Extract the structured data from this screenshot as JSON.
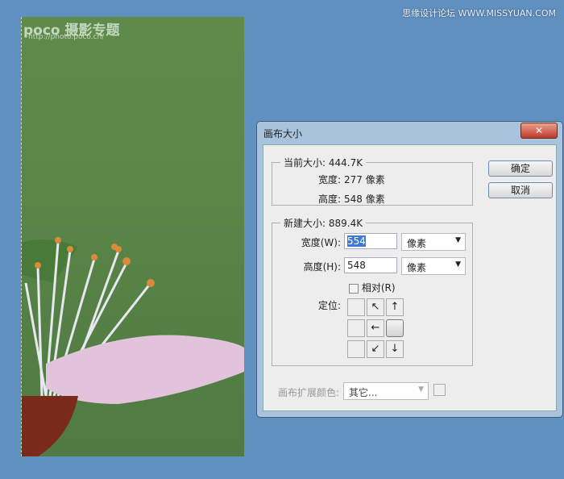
{
  "watermark": {
    "site": "思缘设计论坛 WWW.MISSYUAN.COM",
    "logo": "poco 摄影专题",
    "url": "http://photo.poco.cn/"
  },
  "dialog": {
    "title": "画布大小",
    "close": "✕",
    "current": {
      "legend": "当前大小: 444.7K",
      "width_label": "宽度:",
      "width_value": "277 像素",
      "height_label": "高度:",
      "height_value": "548 像素"
    },
    "new": {
      "legend": "新建大小: 889.4K",
      "width_label": "宽度(W):",
      "width_value": "554",
      "width_unit": "像素",
      "height_label": "高度(H):",
      "height_value": "548",
      "height_unit": "像素",
      "relative": "相对(R)",
      "anchor_label": "定位:",
      "anchor": [
        "",
        "↖",
        "↑",
        "",
        "←",
        "",
        "",
        "↙",
        "↓"
      ]
    },
    "ok": "确定",
    "cancel": "取消",
    "ext_color_label": "画布扩展颜色:",
    "ext_color_value": "其它..."
  }
}
